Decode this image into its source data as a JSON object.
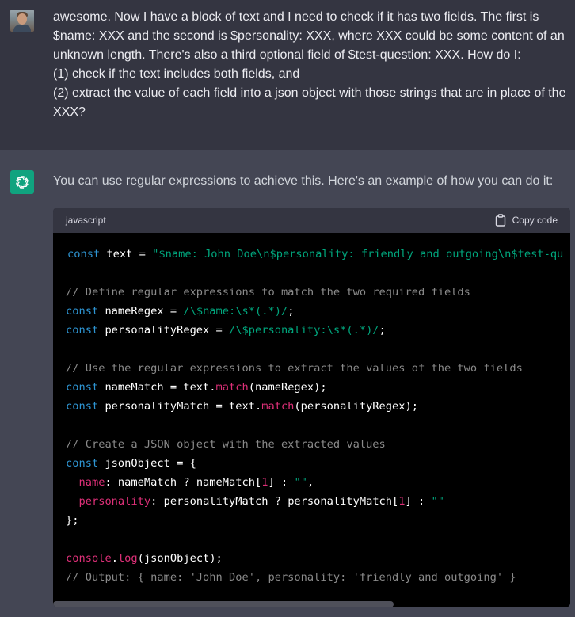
{
  "user_message": {
    "lines": [
      "awesome. Now I have a block of text and I need to check if it has two fields. The first is",
      "$name: XXX and the second is $personality: XXX, where XXX could be some content of an",
      "unknown length. There's also a third optional field of $test-question: XXX.  How do I:",
      "(1) check if the text includes both fields, and",
      "(2) extract the value of each field into a json object with those strings that are in place of the",
      "XXX?"
    ]
  },
  "assistant_message": {
    "intro": "You can use regular expressions to achieve this. Here's an example of how you can do it:"
  },
  "code_block": {
    "language": "javascript",
    "copy_label": "Copy code",
    "lines": [
      [
        {
          "t": "const",
          "c": "kw"
        },
        {
          "t": " text = ",
          "c": "plain"
        },
        {
          "t": "\"$name: John Doe\\n$personality: friendly and outgoing\\n$test-qu",
          "c": "str"
        }
      ],
      [],
      [
        {
          "t": "// Define regular expressions to match the two required fields",
          "c": "cm"
        }
      ],
      [
        {
          "t": "const",
          "c": "kw"
        },
        {
          "t": " nameRegex = ",
          "c": "plain"
        },
        {
          "t": "/\\$name:\\s*(.*)/",
          "c": "str"
        },
        {
          "t": ";",
          "c": "plain"
        }
      ],
      [
        {
          "t": "const",
          "c": "kw"
        },
        {
          "t": " personalityRegex = ",
          "c": "plain"
        },
        {
          "t": "/\\$personality:\\s*(.*)/",
          "c": "str"
        },
        {
          "t": ";",
          "c": "plain"
        }
      ],
      [],
      [
        {
          "t": "// Use the regular expressions to extract the values of the two fields",
          "c": "cm"
        }
      ],
      [
        {
          "t": "const",
          "c": "kw"
        },
        {
          "t": " nameMatch = text.",
          "c": "plain"
        },
        {
          "t": "match",
          "c": "fn"
        },
        {
          "t": "(nameRegex);",
          "c": "plain"
        }
      ],
      [
        {
          "t": "const",
          "c": "kw"
        },
        {
          "t": " personalityMatch = text.",
          "c": "plain"
        },
        {
          "t": "match",
          "c": "fn"
        },
        {
          "t": "(personalityRegex);",
          "c": "plain"
        }
      ],
      [],
      [
        {
          "t": "// Create a JSON object with the extracted values",
          "c": "cm"
        }
      ],
      [
        {
          "t": "const",
          "c": "kw"
        },
        {
          "t": " jsonObject = {",
          "c": "plain"
        }
      ],
      [
        {
          "t": "  ",
          "c": "plain"
        },
        {
          "t": "name",
          "c": "prop"
        },
        {
          "t": ": nameMatch ? nameMatch[",
          "c": "plain"
        },
        {
          "t": "1",
          "c": "num"
        },
        {
          "t": "] : ",
          "c": "plain"
        },
        {
          "t": "\"\"",
          "c": "str"
        },
        {
          "t": ",",
          "c": "plain"
        }
      ],
      [
        {
          "t": "  ",
          "c": "plain"
        },
        {
          "t": "personality",
          "c": "prop"
        },
        {
          "t": ": personalityMatch ? personalityMatch[",
          "c": "plain"
        },
        {
          "t": "1",
          "c": "num"
        },
        {
          "t": "] : ",
          "c": "plain"
        },
        {
          "t": "\"\"",
          "c": "str"
        }
      ],
      [
        {
          "t": "};",
          "c": "plain"
        }
      ],
      [],
      [
        {
          "t": "console",
          "c": "prop"
        },
        {
          "t": ".",
          "c": "plain"
        },
        {
          "t": "log",
          "c": "fn"
        },
        {
          "t": "(jsonObject);",
          "c": "plain"
        }
      ],
      [
        {
          "t": "// Output: { name: 'John Doe', personality: 'friendly and outgoing' }",
          "c": "cm"
        }
      ]
    ]
  },
  "icons": {
    "user_avatar": "user-avatar-photo",
    "assistant_avatar": "openai-logo-icon",
    "copy": "clipboard-icon"
  },
  "colors": {
    "page_bg": "#444654",
    "user_bg": "#343541",
    "gpt_green": "#10a37f",
    "keyword": "#2e95d3",
    "string": "#00a67d",
    "comment": "#8a8a8a",
    "accent": "#df3079"
  }
}
